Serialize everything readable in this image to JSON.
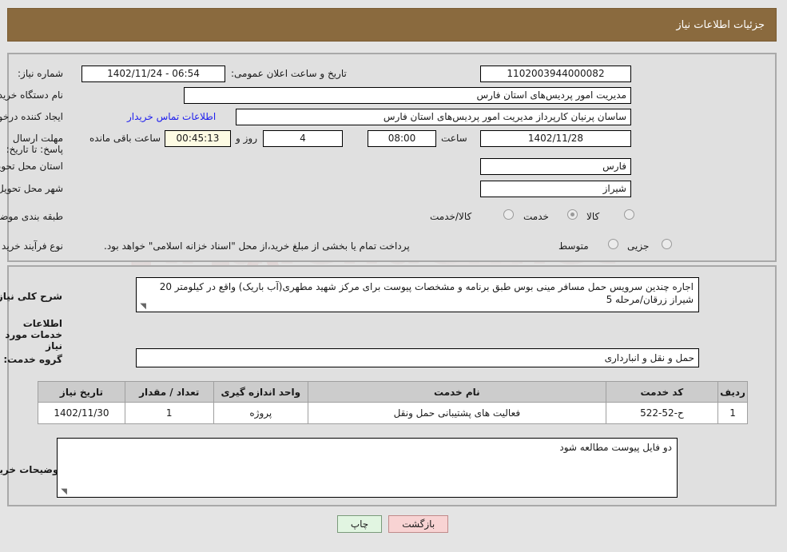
{
  "header": {
    "title": "جزئیات اطلاعات نیاز"
  },
  "colors": {
    "header_bg": "#8a6a3e",
    "header_text": "#ffffff",
    "panel_bg": "#e0e0e0",
    "page_bg": "#e4e4e4",
    "link": "#2020ee",
    "countdown_bg": "#fdfbe3",
    "table_header_bg": "#cccccc",
    "print_button_bg": "#e1f5e1",
    "back_button_bg": "#f8d3d3"
  },
  "need_info": {
    "need_number_label": "شماره نیاز:",
    "need_number_value": "1102003944000082",
    "announce_datetime_label": "تاریخ و ساعت اعلان عمومی:",
    "announce_datetime_value": "1402/11/24 - 06:54",
    "buyer_org_label": "نام دستگاه خریدار:",
    "buyer_org_value": "مدیریت امور پردیس‌های استان فارس",
    "requester_label": "ایجاد کننده درخواست:",
    "requester_value": "ساسان پرنیان کارپرداز مدیریت امور پردیس‌های استان فارس",
    "buyer_contact_link": "اطلاعات تماس خریدار",
    "deadline_label": "مهلت ارسال پاسخ: تا تاریخ:",
    "deadline_date_value": "1402/11/28",
    "deadline_hour_label": "ساعت",
    "deadline_hour_value": "08:00",
    "days_value": "4",
    "days_separator_label": "روز و",
    "countdown_value": "00:45:13",
    "remaining_label": "ساعت باقی مانده",
    "province_label": "استان محل تحویل:",
    "province_value": "فارس",
    "city_label": "شهر محل تحویل:",
    "city_value": "شیراز",
    "category_label": "طبقه بندی موضوعی:",
    "category_options": [
      {
        "label": "کالا",
        "selected": false
      },
      {
        "label": "خدمت",
        "selected": true
      },
      {
        "label": "کالا/خدمت",
        "selected": false
      }
    ],
    "process_label": "نوع فرآیند خرید :",
    "process_options": [
      {
        "label": "جزیی",
        "selected": false
      },
      {
        "label": "متوسط",
        "selected": false
      }
    ],
    "process_note": "پرداخت تمام یا بخشی از مبلغ خرید،از محل \"اسناد خزانه اسلامی\" خواهد بود."
  },
  "description": {
    "label": "شرح کلی نیاز:",
    "value": "اجاره  چندین سرویس حمل مسافر مینی بوس طبق برنامه و مشخصات پیوست برای مرکز شهید مطهری(آب باریک) واقع در کیلومتر 20 شیراز زرقان/مرحله 5"
  },
  "services_section": {
    "title": "اطلاعات خدمات مورد نیاز",
    "group_label": "گروه خدمت:",
    "group_value": "حمل و نقل و انبارداری",
    "table": {
      "columns": [
        "ردیف",
        "کد خدمت",
        "نام خدمت",
        "واحد اندازه گیری",
        "تعداد / مقدار",
        "تاریخ نیاز"
      ],
      "rows": [
        {
          "row": "1",
          "code": "ح-52-522",
          "name": "فعالیت های پشتیبانی حمل ونقل",
          "unit": "پروژه",
          "qty": "1",
          "date": "1402/11/30"
        }
      ]
    }
  },
  "buyer_notes": {
    "label": "توضیحات خریدار:",
    "value": "دو  فایل پیوست مطالعه شود"
  },
  "footer": {
    "print_label": "چاپ",
    "back_label": "بازگشت"
  },
  "watermark": {
    "text": "AriaTender.net"
  }
}
